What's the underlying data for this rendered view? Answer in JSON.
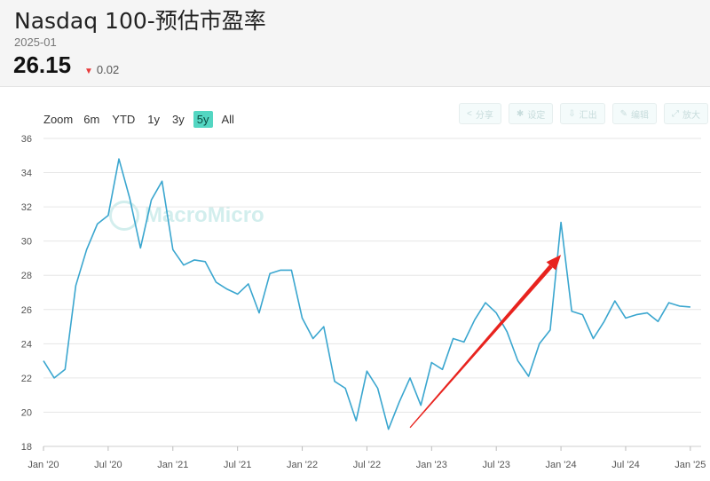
{
  "header": {
    "title": "Nasdaq 100-预估市盈率",
    "date": "2025-01",
    "value": "26.15",
    "change": "0.02",
    "change_color": "#e83b3b"
  },
  "zoom": {
    "label": "Zoom",
    "options": [
      "6m",
      "YTD",
      "1y",
      "3y",
      "5y",
      "All"
    ],
    "selected": "5y"
  },
  "tools": [
    {
      "icon": "share-icon",
      "label": "分享"
    },
    {
      "icon": "gear-icon",
      "label": "设定"
    },
    {
      "icon": "export-icon",
      "label": "汇出"
    },
    {
      "icon": "pencil-icon",
      "label": "编辑"
    },
    {
      "icon": "fullscreen-icon",
      "label": "放大"
    }
  ],
  "watermark": "MacroMicro",
  "chart_data": {
    "type": "line",
    "title": "",
    "xlabel": "",
    "ylabel": "",
    "ylim": [
      18,
      36
    ],
    "yticks": [
      18,
      20,
      22,
      24,
      26,
      28,
      30,
      32,
      34,
      36
    ],
    "xlim": [
      "2020-01",
      "2025-02"
    ],
    "xticks": [
      {
        "date": "2020-01",
        "label": "Jan '20"
      },
      {
        "date": "2020-07",
        "label": "Jul '20"
      },
      {
        "date": "2021-01",
        "label": "Jan '21"
      },
      {
        "date": "2021-07",
        "label": "Jul '21"
      },
      {
        "date": "2022-01",
        "label": "Jan '22"
      },
      {
        "date": "2022-07",
        "label": "Jul '22"
      },
      {
        "date": "2023-01",
        "label": "Jan '23"
      },
      {
        "date": "2023-07",
        "label": "Jul '23"
      },
      {
        "date": "2024-01",
        "label": "Jan '24"
      },
      {
        "date": "2024-07",
        "label": "Jul '24"
      },
      {
        "date": "2025-01",
        "label": "Jan '25"
      }
    ],
    "grid": true,
    "line_color": "#3aa6cf",
    "series": [
      {
        "x": [
          "2020-01",
          "2020-02",
          "2020-03",
          "2020-04",
          "2020-05",
          "2020-06",
          "2020-07",
          "2020-08",
          "2020-09",
          "2020-10",
          "2020-11",
          "2020-12",
          "2021-01",
          "2021-02",
          "2021-03",
          "2021-04",
          "2021-05",
          "2021-06",
          "2021-07",
          "2021-08",
          "2021-09",
          "2021-10",
          "2021-11",
          "2021-12",
          "2022-01",
          "2022-02",
          "2022-03",
          "2022-04",
          "2022-05",
          "2022-06",
          "2022-07",
          "2022-08",
          "2022-09",
          "2022-10",
          "2022-11",
          "2022-12",
          "2023-01",
          "2023-02",
          "2023-03",
          "2023-04",
          "2023-05",
          "2023-06",
          "2023-07",
          "2023-08",
          "2023-09",
          "2023-10",
          "2023-11",
          "2023-12",
          "2024-01",
          "2024-02",
          "2024-03",
          "2024-04",
          "2024-05",
          "2024-06",
          "2024-07",
          "2024-08",
          "2024-09",
          "2024-10",
          "2024-11",
          "2024-12",
          "2025-01"
        ],
        "y": [
          23.0,
          22.0,
          22.5,
          27.4,
          29.5,
          31.0,
          31.5,
          34.8,
          32.5,
          29.6,
          32.4,
          33.5,
          29.5,
          28.6,
          28.9,
          28.8,
          27.6,
          27.2,
          26.9,
          27.5,
          25.8,
          28.1,
          28.3,
          28.3,
          25.5,
          24.3,
          25.0,
          21.8,
          21.4,
          19.5,
          22.4,
          21.4,
          19.0,
          20.6,
          22.0,
          20.4,
          22.9,
          22.5,
          24.3,
          24.1,
          25.4,
          26.4,
          25.8,
          24.7,
          23.0,
          22.1,
          24.0,
          24.8,
          31.1,
          25.9,
          25.7,
          24.3,
          25.3,
          26.5,
          25.5,
          25.7,
          25.8,
          25.3,
          26.4,
          26.2,
          26.15
        ]
      }
    ],
    "annotations": [
      {
        "type": "arrow",
        "color": "#e8231e",
        "from": [
          "2022-11",
          19.1
        ],
        "to": [
          "2024-01",
          29.2
        ]
      }
    ]
  }
}
